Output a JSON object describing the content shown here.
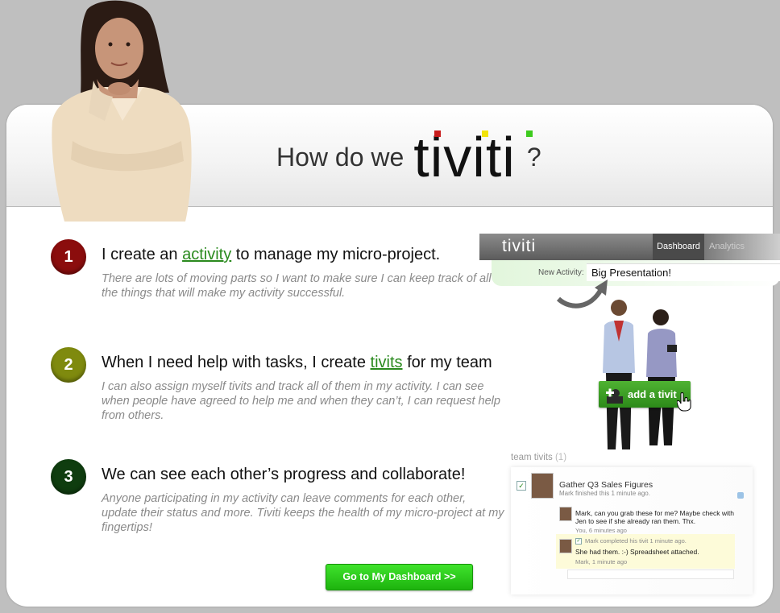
{
  "header": {
    "how": "How do we",
    "logo": "tiviti",
    "question_mark": "?",
    "colors": {
      "red": "#c81c1c",
      "yellow": "#f2e40a",
      "green": "#3ecb1e"
    }
  },
  "steps": [
    {
      "number": "1",
      "title_before": "I create an",
      "link": "activity",
      "title_after": "to manage my micro-project.",
      "description": "There are lots of moving parts so I want to make sure I can keep track of all the things that will make my activity successful.",
      "color": "#8b0d0d"
    },
    {
      "number": "2",
      "title_before": "When I need help with tasks, I create",
      "link": "tivits",
      "title_after": "for my team",
      "description": "I can also assign myself tivits and track all of them in my activity.  I can see when people have agreed to help me and when they can’t, I can request help from others.",
      "color": "#7f8a0e"
    },
    {
      "number": "3",
      "title_before": "We can see each other’s progress and collaborate!",
      "link": "",
      "title_after": "",
      "description": "Anyone participating in my activity can leave comments for each other, update their status and more.  Tiviti keeps the health of my micro-project at my fingertips!",
      "color": "#0f3d0f"
    }
  ],
  "dashboard_button": "Go to My Dashboard >>",
  "mock_app": {
    "logo": "tiviti",
    "tabs": [
      "Dashboard",
      "Analytics"
    ],
    "new_activity_label": "New Activity:",
    "new_activity_value": "Big Presentation!",
    "add_tivit": "add a tivit"
  },
  "team_panel": {
    "label": "team tivits",
    "count": "(1)",
    "task_title": "Gather Q3 Sales Figures",
    "task_status": "Mark finished this 1 minute ago.",
    "comment1": "Mark, can you grab these for me? Maybe check with Jen to see if she already ran them. Thx.",
    "comment1_meta": "You, 6 minutes ago",
    "completed_note": "Mark completed his tivit 1 minute ago.",
    "comment2": "She had them. :-) Spreadsheet attached.",
    "comment2_meta": "Mark, 1 minute ago"
  }
}
